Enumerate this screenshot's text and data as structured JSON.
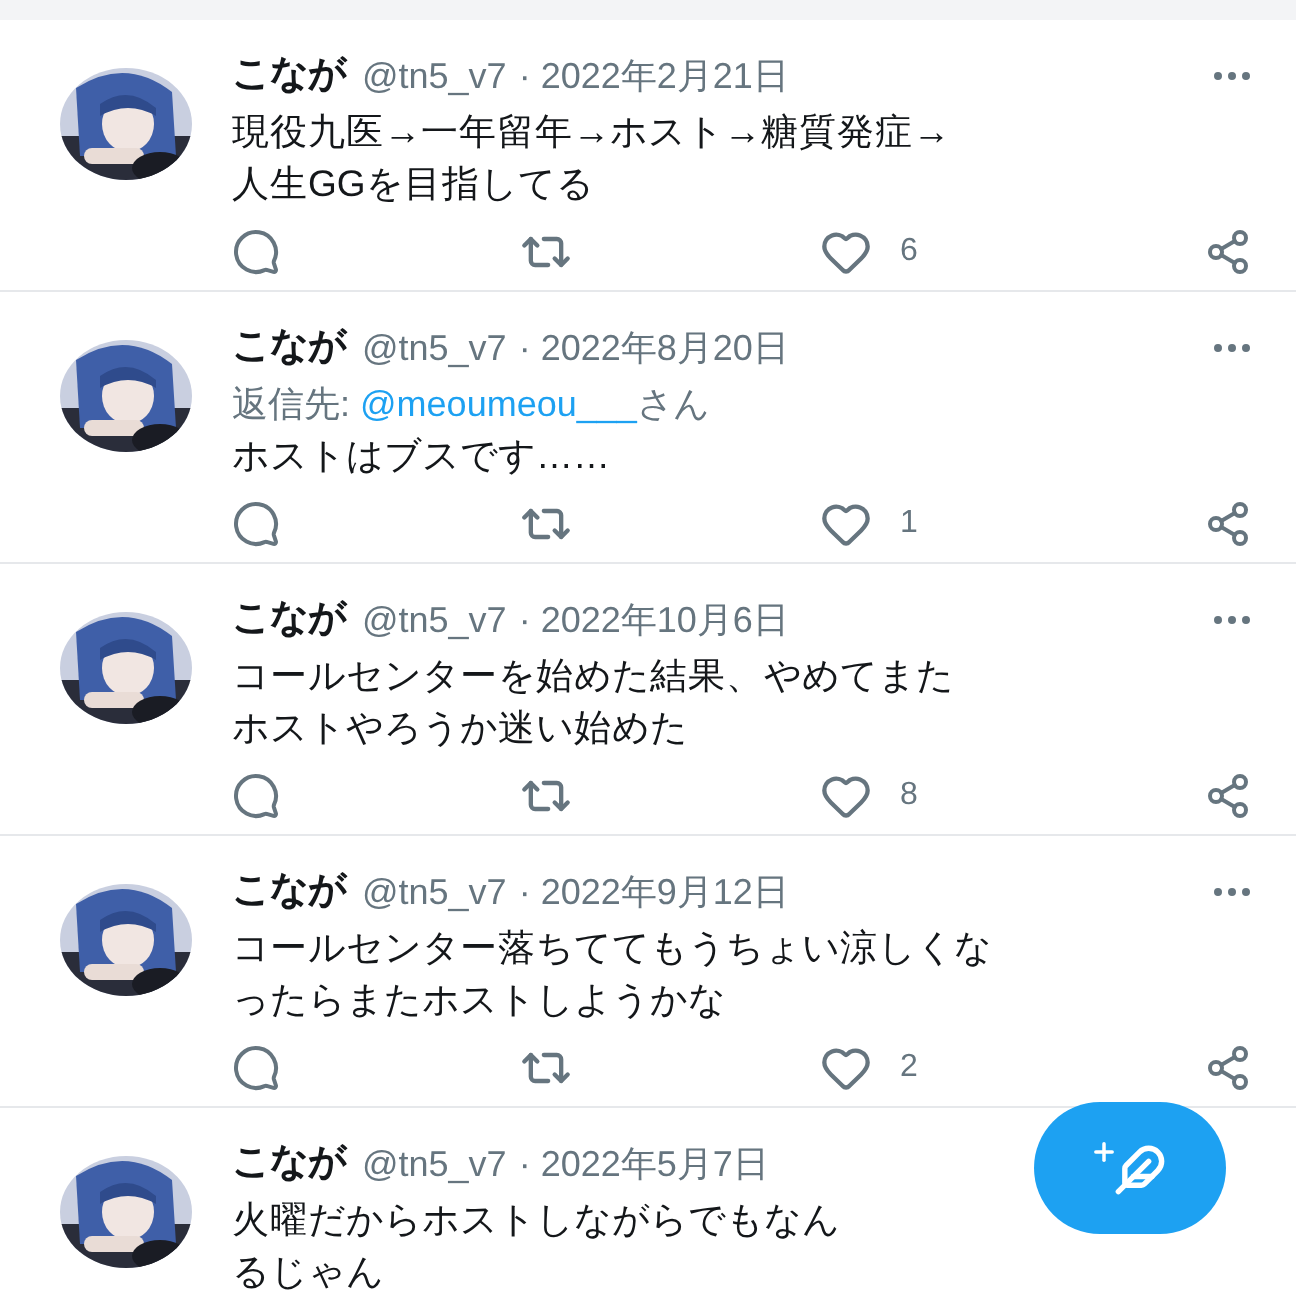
{
  "tweets": [
    {
      "name": "こなが",
      "handle": "@tn5_v7",
      "date": "· 2022年2月21日",
      "menu_visible": true,
      "lines": [
        "現役九医→一年留年→ホスト→糖質発症→",
        "人生GGを目指してる"
      ],
      "likes": "6"
    },
    {
      "name": "こなが",
      "handle": "@tn5_v7",
      "date": "· 2022年8月20日",
      "menu_visible": true,
      "reply_to": {
        "prefix": "返信先:",
        "handle": "@meoumeou___",
        "suffix": "さん"
      },
      "lines": [
        "ホストはブスです……"
      ],
      "likes": "1"
    },
    {
      "name": "こなが",
      "handle": "@tn5_v7",
      "date": "· 2022年10月6日",
      "menu_visible": true,
      "lines": [
        "コールセンターを始めた結果、やめてまた",
        "ホストやろうか迷い始めた"
      ],
      "likes": "8"
    },
    {
      "name": "こなが",
      "handle": "@tn5_v7",
      "date": "· 2022年9月12日",
      "menu_visible": true,
      "lines": [
        "コールセンター落ちててもうちょい涼しくな",
        "ったらまたホストしようかな"
      ],
      "likes": "2"
    },
    {
      "name": "こなが",
      "handle": "@tn5_v7",
      "date": "· 2022年5月7日",
      "menu_visible": false,
      "lines": [
        "火曜だからホストしながらでもなん",
        "るじゃん"
      ]
    }
  ]
}
